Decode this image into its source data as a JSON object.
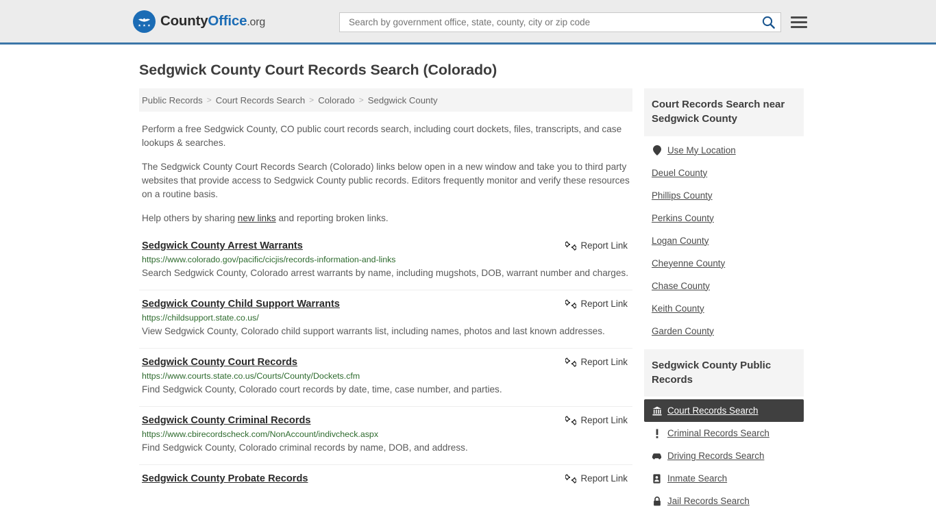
{
  "header": {
    "logo": {
      "part1": "County",
      "part2": "Office",
      "part3": ".org",
      "icon": "eagle-seal-icon"
    },
    "search": {
      "placeholder": "Search by government office, state, county, city or zip code",
      "value": ""
    },
    "search_icon": "search-icon",
    "menu_icon": "hamburger-menu-icon"
  },
  "page": {
    "title": "Sedgwick County Court Records Search (Colorado)"
  },
  "breadcrumb": [
    {
      "label": "Public Records"
    },
    {
      "label": "Court Records Search"
    },
    {
      "label": "Colorado"
    },
    {
      "label": "Sedgwick County"
    }
  ],
  "breadcrumb_separator": ">",
  "intro": {
    "p1": "Perform a free Sedgwick County, CO public court records search, including court dockets, files, transcripts, and case lookups & searches.",
    "p2": "The Sedgwick County Court Records Search (Colorado) links below open in a new window and take you to third party websites that provide access to Sedgwick County public records. Editors frequently monitor and verify these resources on a routine basis.",
    "p3_before": "Help others by sharing ",
    "p3_link": "new links",
    "p3_after": " and reporting broken links."
  },
  "report_link_label": "Report Link",
  "report_link_icon": "broken-link-icon",
  "results": [
    {
      "title": "Sedgwick County Arrest Warrants",
      "url": "https://www.colorado.gov/pacific/cicjis/records-information-and-links",
      "description": "Search Sedgwick County, Colorado arrest warrants by name, including mugshots, DOB, warrant number and charges."
    },
    {
      "title": "Sedgwick County Child Support Warrants",
      "url": "https://childsupport.state.co.us/",
      "description": "View Sedgwick County, Colorado child support warrants list, including names, photos and last known addresses."
    },
    {
      "title": "Sedgwick County Court Records",
      "url": "https://www.courts.state.co.us/Courts/County/Dockets.cfm",
      "description": "Find Sedgwick County, Colorado court records by date, time, case number, and parties."
    },
    {
      "title": "Sedgwick County Criminal Records",
      "url": "https://www.cbirecordscheck.com/NonAccount/indivcheck.aspx",
      "description": "Find Sedgwick County, Colorado criminal records by name, DOB, and address."
    },
    {
      "title": "Sedgwick County Probate Records",
      "url": "",
      "description": ""
    }
  ],
  "sidebar": {
    "nearby": {
      "heading": "Court Records Search near Sedgwick County",
      "use_my_location": {
        "label": "Use My Location",
        "icon": "map-pin-icon"
      },
      "counties": [
        {
          "label": "Deuel County"
        },
        {
          "label": "Phillips County"
        },
        {
          "label": "Perkins County"
        },
        {
          "label": "Logan County"
        },
        {
          "label": "Cheyenne County"
        },
        {
          "label": "Chase County"
        },
        {
          "label": "Keith County"
        },
        {
          "label": "Garden County"
        }
      ]
    },
    "public_records": {
      "heading": "Sedgwick County Public Records",
      "items": [
        {
          "label": "Court Records Search",
          "icon": "bank-building-icon",
          "active": true
        },
        {
          "label": "Criminal Records Search",
          "icon": "exclamation-icon",
          "active": false
        },
        {
          "label": "Driving Records Search",
          "icon": "car-icon",
          "active": false
        },
        {
          "label": "Inmate Search",
          "icon": "id-badge-icon",
          "active": false
        },
        {
          "label": "Jail Records Search",
          "icon": "lock-icon",
          "active": false
        }
      ]
    }
  },
  "colors": {
    "header_bg": "#ececec",
    "header_border": "#3c76a8",
    "brand_blue": "#1b6cb5",
    "url_green": "#2d6a2d",
    "active_bg": "#404040",
    "card_bg": "#f4f4f4"
  }
}
